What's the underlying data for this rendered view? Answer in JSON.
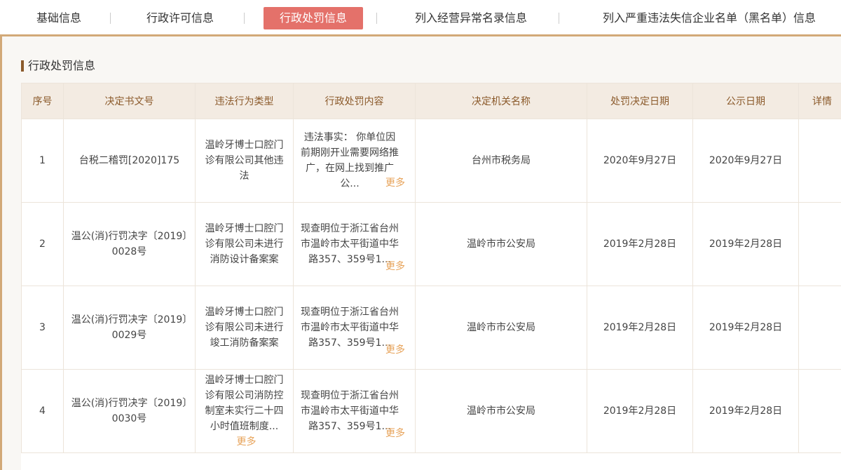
{
  "tabs": [
    {
      "label": "基础信息",
      "active": false
    },
    {
      "label": "行政许可信息",
      "active": false
    },
    {
      "label": "行政处罚信息",
      "active": true
    },
    {
      "label": "列入经营异常名录信息",
      "active": false
    },
    {
      "label": "列入严重违法失信企业名单（黑名单）信息",
      "active": false
    }
  ],
  "section": {
    "title": "行政处罚信息"
  },
  "table": {
    "headers": [
      "序号",
      "决定书文号",
      "违法行为类型",
      "行政处罚内容",
      "决定机关名称",
      "处罚决定日期",
      "公示日期",
      "详情"
    ],
    "rows": [
      {
        "index": "1",
        "doc_no": "台税二稽罚[2020]175",
        "violation": "温岭牙博士口腔门诊有限公司其他违法",
        "content": "违法事实： 你单位因前期刚开业需要网络推广，在网上找到推广公...",
        "more": "更多",
        "authority": "台州市税务局",
        "decision_date": "2020年9月27日",
        "publish_date": "2020年9月27日"
      },
      {
        "index": "2",
        "doc_no": "温公(消)行罚决字〔2019〕0028号",
        "violation": "温岭牙博士口腔门诊有限公司未进行消防设计备案案",
        "content": "现查明位于浙江省台州市温岭市太平街道中华路357、359号1...",
        "more": "更多",
        "authority": "温岭市市公安局",
        "decision_date": "2019年2月28日",
        "publish_date": "2019年2月28日"
      },
      {
        "index": "3",
        "doc_no": "温公(消)行罚决字〔2019〕0029号",
        "violation": "温岭牙博士口腔门诊有限公司未进行竣工消防备案案",
        "content": "现查明位于浙江省台州市温岭市太平街道中华路357、359号1...",
        "more": "更多",
        "authority": "温岭市市公安局",
        "decision_date": "2019年2月28日",
        "publish_date": "2019年2月28日"
      },
      {
        "index": "4",
        "doc_no": "温公(消)行罚决字〔2019〕0030号",
        "violation": "温岭牙博士口腔门诊有限公司消防控制室未实行二十四小时值班制度...",
        "violation_more": "更多",
        "content": "现查明位于浙江省台州市温岭市太平街道中华路357、359号1...",
        "more": "更多",
        "authority": "温岭市市公安局",
        "decision_date": "2019年2月28日",
        "publish_date": "2019年2月28日"
      }
    ]
  }
}
